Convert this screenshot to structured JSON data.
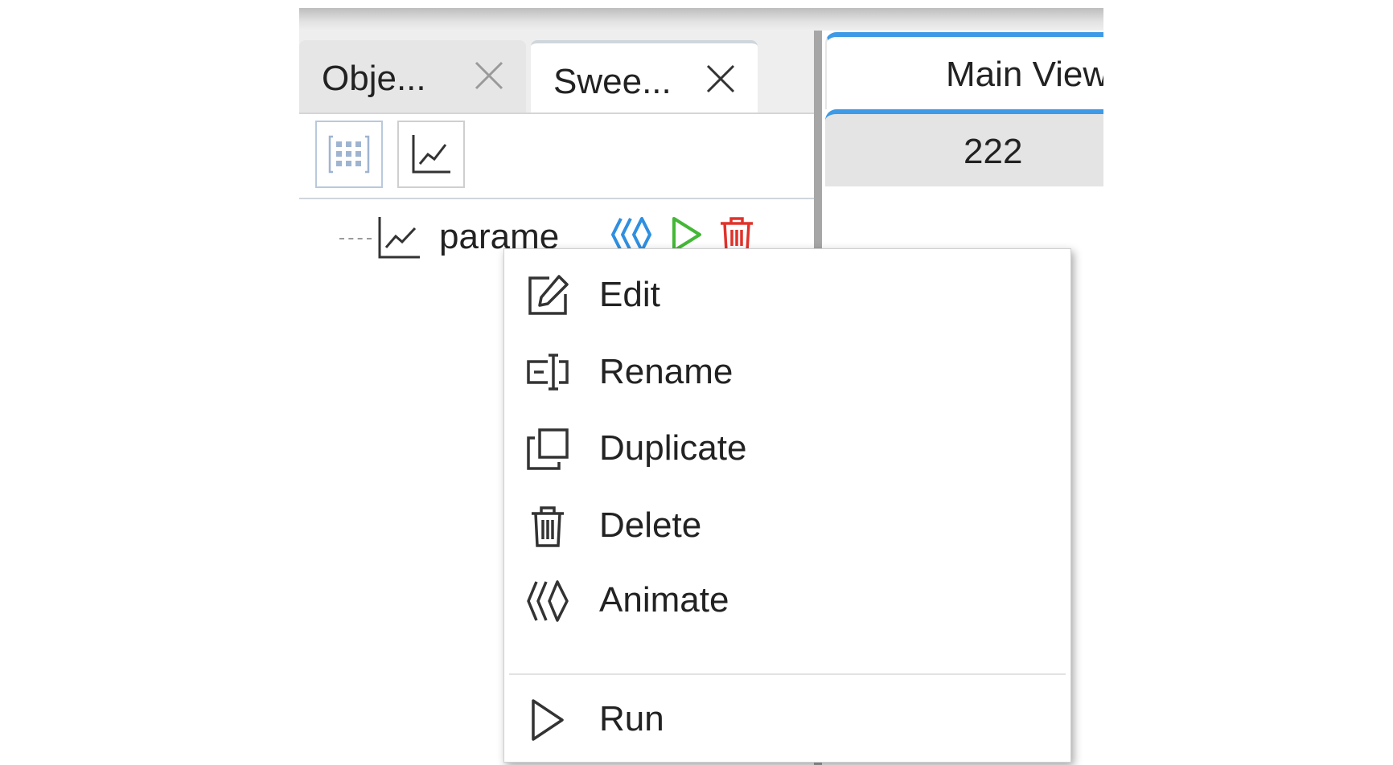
{
  "left_panel": {
    "tabs": [
      {
        "label": "Obje...",
        "close_icon": "close-icon"
      },
      {
        "label": "Swee...",
        "close_icon": "close-icon"
      }
    ],
    "toolbar": [
      {
        "icon": "grid-icon"
      },
      {
        "icon": "line-chart-icon"
      }
    ],
    "tree": {
      "item_label": "parame",
      "item_icon": "line-chart-icon",
      "actions": [
        {
          "icon": "animate-icon",
          "color": "#2f8fe0"
        },
        {
          "icon": "play-icon",
          "color": "#44b836"
        },
        {
          "icon": "trash-icon",
          "color": "#e0322a"
        }
      ]
    }
  },
  "right_panel": {
    "main_tab": "Main View",
    "sub_tab": "222",
    "accent": "#3e9ae6"
  },
  "context_menu": {
    "items": [
      {
        "label": "Edit",
        "icon": "edit-icon"
      },
      {
        "label": "Rename",
        "icon": "rename-icon"
      },
      {
        "label": "Duplicate",
        "icon": "duplicate-icon"
      },
      {
        "label": "Delete",
        "icon": "trash-icon"
      },
      {
        "label": "Animate",
        "icon": "animate-icon"
      },
      {
        "label": "Run",
        "icon": "play-icon"
      }
    ]
  }
}
